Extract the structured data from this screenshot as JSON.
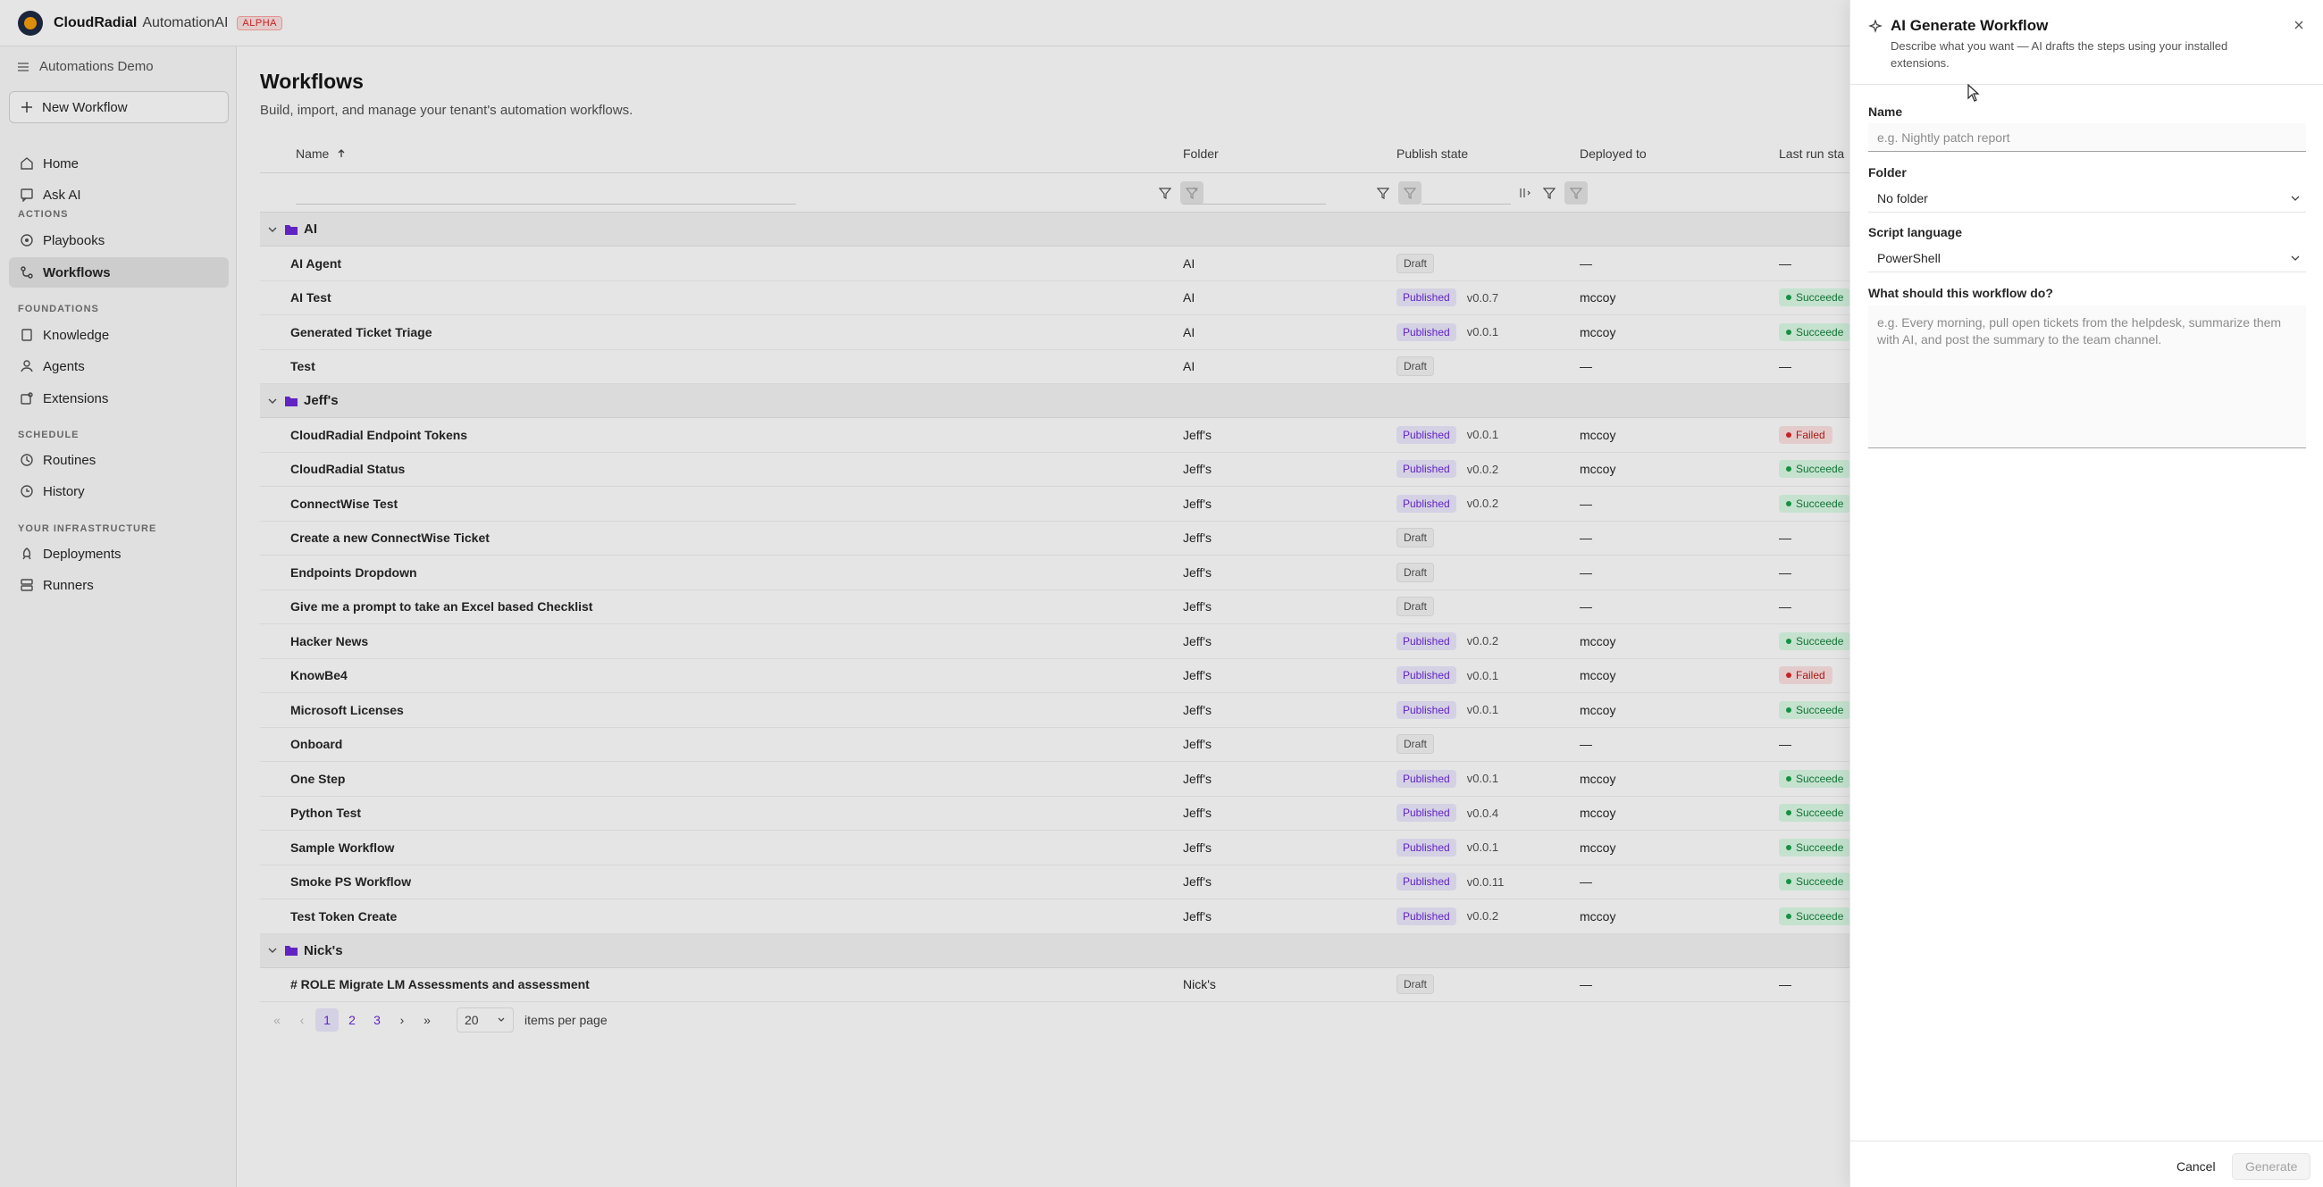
{
  "app": {
    "brand": "CloudRadial",
    "product": "AutomationAI",
    "badge": "ALPHA"
  },
  "sidebar": {
    "workspace": "Automations Demo",
    "new_workflow": "New Workflow",
    "items": [
      {
        "label": "Home",
        "icon": "home-icon"
      },
      {
        "label": "Ask AI",
        "icon": "chat-icon"
      },
      {
        "label": "Playbooks",
        "icon": "playbook-icon"
      },
      {
        "label": "Workflows",
        "icon": "workflow-icon"
      },
      {
        "label": "Knowledge",
        "icon": "book-icon"
      },
      {
        "label": "Agents",
        "icon": "agent-icon"
      },
      {
        "label": "Extensions",
        "icon": "puzzle-icon"
      },
      {
        "label": "Routines",
        "icon": "clock-icon"
      },
      {
        "label": "History",
        "icon": "history-icon"
      },
      {
        "label": "Deployments",
        "icon": "rocket-icon"
      },
      {
        "label": "Runners",
        "icon": "server-icon"
      }
    ],
    "sections": [
      "ACTIONS",
      "FOUNDATIONS",
      "SCHEDULE",
      "YOUR INFRASTRUCTURE"
    ]
  },
  "page": {
    "title": "Workflows",
    "subtitle": "Build, import, and manage your tenant's automation workflows."
  },
  "table": {
    "columns": {
      "name": "Name",
      "folder": "Folder",
      "publish": "Publish state",
      "deployed": "Deployed to",
      "lastrun": "Last run sta"
    },
    "groups": [
      {
        "name": "AI",
        "rows": [
          {
            "name": "AI Agent",
            "folder": "AI",
            "state": "Draft",
            "ver": "",
            "dep": "—",
            "run": "—",
            "runtype": ""
          },
          {
            "name": "AI Test",
            "folder": "AI",
            "state": "Published",
            "ver": "v0.0.7",
            "dep": "mccoy",
            "run": "Succeede",
            "runtype": "ok"
          },
          {
            "name": "Generated Ticket Triage",
            "folder": "AI",
            "state": "Published",
            "ver": "v0.0.1",
            "dep": "mccoy",
            "run": "Succeede",
            "runtype": "ok"
          },
          {
            "name": "Test",
            "folder": "AI",
            "state": "Draft",
            "ver": "",
            "dep": "—",
            "run": "—",
            "runtype": ""
          }
        ]
      },
      {
        "name": "Jeff's",
        "rows": [
          {
            "name": "CloudRadial Endpoint Tokens",
            "folder": "Jeff's",
            "state": "Published",
            "ver": "v0.0.1",
            "dep": "mccoy",
            "run": "Failed",
            "runtype": "fail"
          },
          {
            "name": "CloudRadial Status",
            "folder": "Jeff's",
            "state": "Published",
            "ver": "v0.0.2",
            "dep": "mccoy",
            "run": "Succeede",
            "runtype": "ok"
          },
          {
            "name": "ConnectWise Test",
            "folder": "Jeff's",
            "state": "Published",
            "ver": "v0.0.2",
            "dep": "—",
            "run": "Succeede",
            "runtype": "ok"
          },
          {
            "name": "Create a new ConnectWise Ticket",
            "folder": "Jeff's",
            "state": "Draft",
            "ver": "",
            "dep": "—",
            "run": "—",
            "runtype": ""
          },
          {
            "name": "Endpoints Dropdown",
            "folder": "Jeff's",
            "state": "Draft",
            "ver": "",
            "dep": "—",
            "run": "—",
            "runtype": ""
          },
          {
            "name": "Give me a prompt to take an Excel based Checklist",
            "folder": "Jeff's",
            "state": "Draft",
            "ver": "",
            "dep": "—",
            "run": "—",
            "runtype": ""
          },
          {
            "name": "Hacker News",
            "folder": "Jeff's",
            "state": "Published",
            "ver": "v0.0.2",
            "dep": "mccoy",
            "run": "Succeede",
            "runtype": "ok"
          },
          {
            "name": "KnowBe4",
            "folder": "Jeff's",
            "state": "Published",
            "ver": "v0.0.1",
            "dep": "mccoy",
            "run": "Failed",
            "runtype": "fail"
          },
          {
            "name": "Microsoft Licenses",
            "folder": "Jeff's",
            "state": "Published",
            "ver": "v0.0.1",
            "dep": "mccoy",
            "run": "Succeede",
            "runtype": "ok"
          },
          {
            "name": "Onboard",
            "folder": "Jeff's",
            "state": "Draft",
            "ver": "",
            "dep": "—",
            "run": "—",
            "runtype": ""
          },
          {
            "name": "One Step",
            "folder": "Jeff's",
            "state": "Published",
            "ver": "v0.0.1",
            "dep": "mccoy",
            "run": "Succeede",
            "runtype": "ok"
          },
          {
            "name": "Python Test",
            "folder": "Jeff's",
            "state": "Published",
            "ver": "v0.0.4",
            "dep": "mccoy",
            "run": "Succeede",
            "runtype": "ok"
          },
          {
            "name": "Sample Workflow",
            "folder": "Jeff's",
            "state": "Published",
            "ver": "v0.0.1",
            "dep": "mccoy",
            "run": "Succeede",
            "runtype": "ok"
          },
          {
            "name": "Smoke PS Workflow",
            "folder": "Jeff's",
            "state": "Published",
            "ver": "v0.0.11",
            "dep": "—",
            "run": "Succeede",
            "runtype": "ok"
          },
          {
            "name": "Test Token Create",
            "folder": "Jeff's",
            "state": "Published",
            "ver": "v0.0.2",
            "dep": "mccoy",
            "run": "Succeede",
            "runtype": "ok"
          }
        ]
      },
      {
        "name": "Nick's",
        "rows": [
          {
            "name": "# ROLE Migrate LM Assessments and assessment",
            "folder": "Nick's",
            "state": "Draft",
            "ver": "",
            "dep": "—",
            "run": "—",
            "runtype": ""
          }
        ]
      }
    ]
  },
  "pagination": {
    "pages": [
      "1",
      "2",
      "3"
    ],
    "per_page": "20",
    "per_page_label": "items per page"
  },
  "drawer": {
    "title": "AI Generate Workflow",
    "description": "Describe what you want — AI drafts the steps using your installed extensions.",
    "name_label": "Name",
    "name_placeholder": "e.g. Nightly patch report",
    "folder_label": "Folder",
    "folder_value": "No folder",
    "language_label": "Script language",
    "language_value": "PowerShell",
    "prompt_label": "What should this workflow do?",
    "prompt_placeholder": "e.g. Every morning, pull open tickets from the helpdesk, summarize them with AI, and post the summary to the team channel.",
    "cancel": "Cancel",
    "generate": "Generate"
  },
  "colors": {
    "accent": "#6d28d9",
    "published_bg": "#ede9fe",
    "success": "#15803d",
    "fail": "#b91c1c"
  }
}
